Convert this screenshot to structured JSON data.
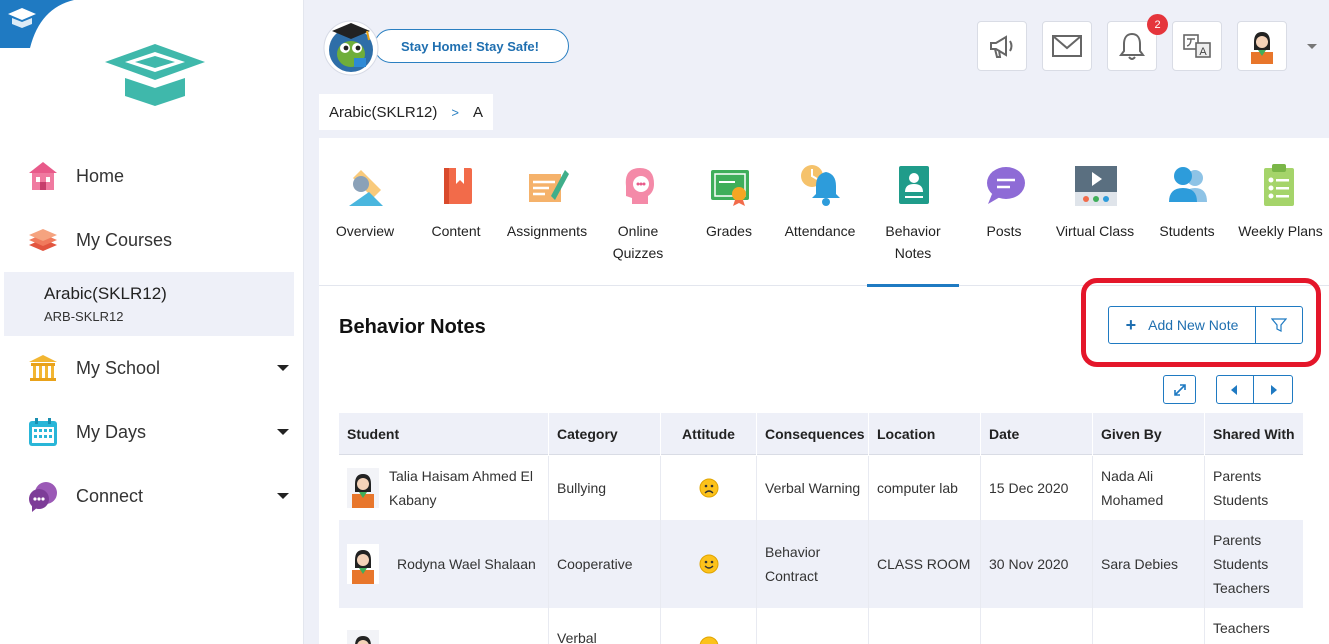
{
  "sidebar": {
    "nav": [
      {
        "label": "Home",
        "icon": "home-icon"
      },
      {
        "label": "My Courses",
        "icon": "books-icon"
      },
      {
        "label": "My School",
        "icon": "school-icon"
      },
      {
        "label": "My Days",
        "icon": "calendar-icon"
      },
      {
        "label": "Connect",
        "icon": "chat-icon"
      }
    ],
    "course": {
      "name": "Arabic(SKLR12)",
      "code": "ARB-SKLR12"
    }
  },
  "topbar": {
    "banner_text": "Stay Home! Stay Safe!",
    "notification_count": "2",
    "icons": [
      "megaphone-icon",
      "mail-icon",
      "bell-icon",
      "translate-icon",
      "user-avatar"
    ]
  },
  "breadcrumb": {
    "course": "Arabic(SKLR12)",
    "separator": ">",
    "section": "A"
  },
  "tabs": [
    {
      "label": "Overview"
    },
    {
      "label": "Content"
    },
    {
      "label": "Assignments"
    },
    {
      "label": "Online Quizzes"
    },
    {
      "label": "Grades"
    },
    {
      "label": "Attendance"
    },
    {
      "label": "Behavior Notes"
    },
    {
      "label": "Posts"
    },
    {
      "label": "Virtual Class"
    },
    {
      "label": "Students"
    },
    {
      "label": "Weekly Plans"
    }
  ],
  "active_tab": "Behavior Notes",
  "section": {
    "title": "Behavior Notes",
    "add_button": "Add New Note"
  },
  "table": {
    "headers": [
      "Student",
      "Category",
      "Attitude",
      "Consequences",
      "Location",
      "Date",
      "Given By",
      "Shared With"
    ],
    "rows": [
      {
        "student": "Talia Haisam Ahmed El Kabany",
        "category": "Bullying",
        "attitude": "negative",
        "consequences": "Verbal Warning",
        "location": "computer lab",
        "date": "15 Dec 2020",
        "given_by": "Nada Ali Mohamed",
        "shared_with": [
          "Parents",
          "Students"
        ]
      },
      {
        "student": "Rodyna Wael Shalaan",
        "category": "Cooperative",
        "attitude": "positive",
        "consequences": "Behavior Contract",
        "location": "CLASS ROOM",
        "date": "30 Nov 2020",
        "given_by": "Sara Debies",
        "shared_with": [
          "Parents",
          "Students",
          "Teachers"
        ]
      },
      {
        "student": "",
        "category": "Verbal",
        "attitude": "positive",
        "consequences": "",
        "location": "",
        "date": "",
        "given_by": "",
        "shared_with": [
          "Teachers"
        ]
      }
    ]
  },
  "colors": {
    "accent": "#1f7ac2",
    "highlight": "#e4162a",
    "badge": "#e5353c"
  }
}
